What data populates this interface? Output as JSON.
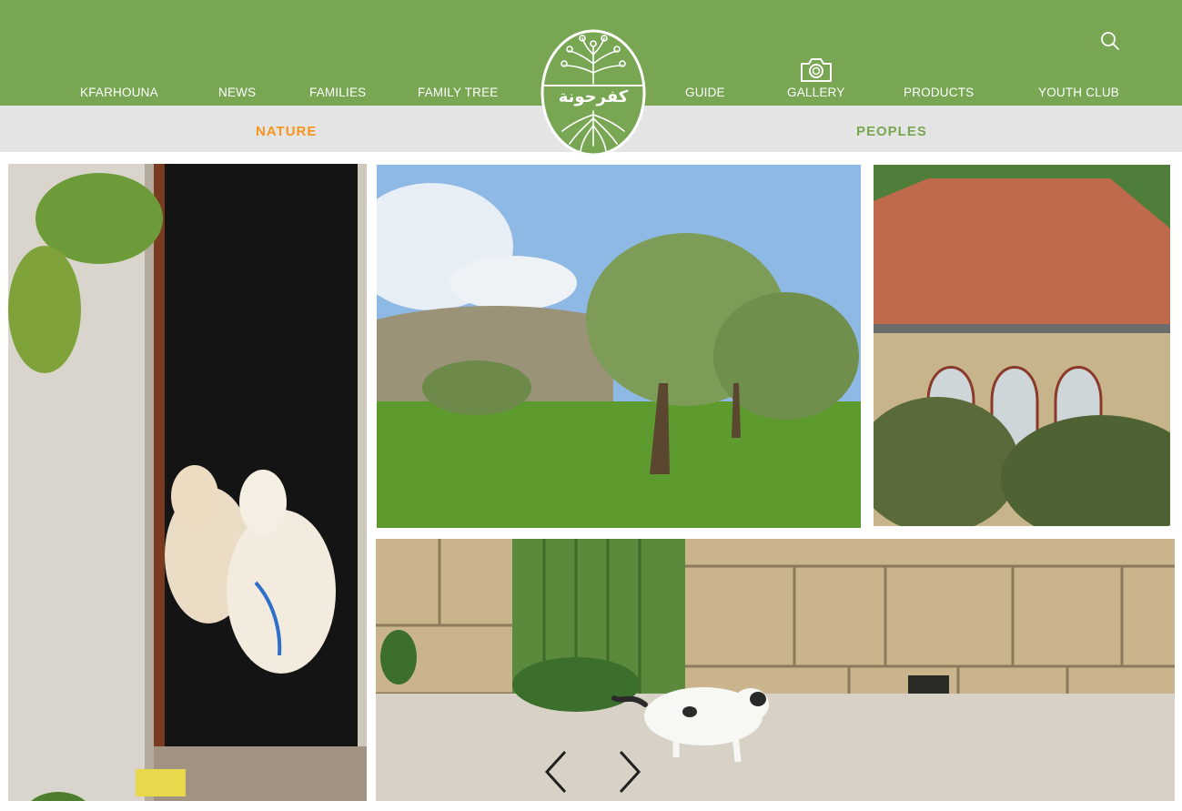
{
  "nav": {
    "items": [
      {
        "label": "KFARHOUNA"
      },
      {
        "label": "NEWS"
      },
      {
        "label": "FAMILIES"
      },
      {
        "label": "FAMILY TREE"
      },
      {
        "label": "GUIDE"
      },
      {
        "label": "GALLERY"
      },
      {
        "label": "PRODUCTS"
      },
      {
        "label": "YOUTH CLUB"
      }
    ],
    "search_icon": "search-icon",
    "gallery_icon": "camera-icon"
  },
  "logo": {
    "text": "كفرحونة"
  },
  "subnav": {
    "tabs": [
      {
        "label": "NATURE",
        "active": true,
        "color": "#f7941d"
      },
      {
        "label": "PEOPLES",
        "active": false,
        "color": "#78a653"
      }
    ]
  },
  "gallery": {
    "photos": [
      {
        "subject": "goats-in-doorway"
      },
      {
        "subject": "olive-grove"
      },
      {
        "subject": "stone-house-red-roof"
      },
      {
        "subject": "cat-by-stone-wall"
      }
    ],
    "prev_icon": "chevron-left-icon",
    "next_icon": "chevron-right-icon"
  },
  "colors": {
    "brand_green": "#78a653",
    "active_orange": "#f7941d",
    "subbar_gray": "#e4e4e4"
  }
}
